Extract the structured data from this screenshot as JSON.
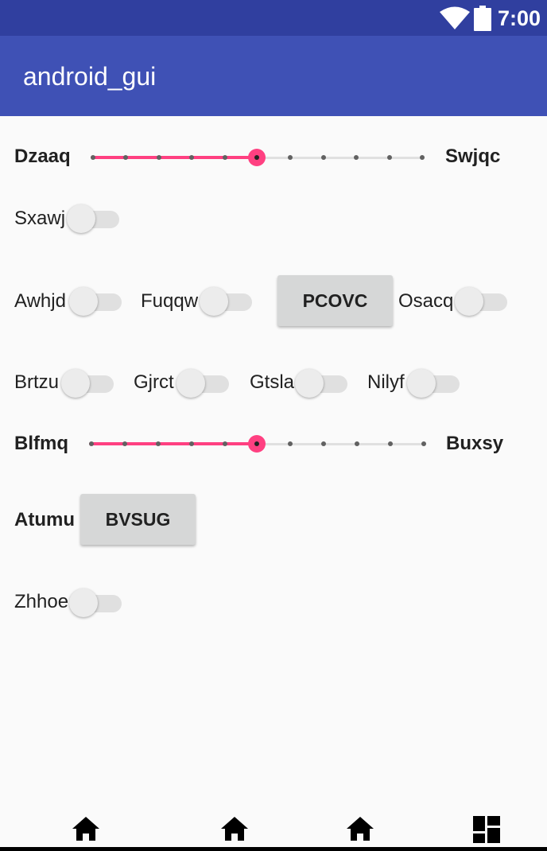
{
  "status_bar": {
    "time": "7:00",
    "icons": [
      "wifi-icon",
      "battery-icon"
    ],
    "color": "#303f9f"
  },
  "app_bar": {
    "title": "android_gui",
    "color": "#3f51b5"
  },
  "accent_color": "#ff4081",
  "rows": {
    "seek1": {
      "start_label": "Dzaaq",
      "end_label": "Swjqc",
      "value": 5,
      "max": 10
    },
    "row2": {
      "switch_label": "Sxawj",
      "checked": false
    },
    "row3": {
      "switch1_label": "Awhjd",
      "switch2_label": "Fuqqw",
      "button_label": "PCOVC",
      "switch3_label": "Osacq"
    },
    "row4": {
      "switch1_label": "Brtzu",
      "switch2_label": "Gjrct",
      "switch3_label": "Gtsla",
      "switch4_label": "Nilyf"
    },
    "seek2": {
      "start_label": "Blfmq",
      "end_label": "Buxsy",
      "value": 5,
      "max": 10
    },
    "row6": {
      "label": "Atumu",
      "button_label": "BVSUG"
    },
    "row7": {
      "switch_label": "Zhhoe",
      "checked": false
    }
  },
  "bottom_nav": {
    "icons": [
      "home-icon",
      "home-icon",
      "home-icon",
      "dashboard-icon"
    ]
  }
}
